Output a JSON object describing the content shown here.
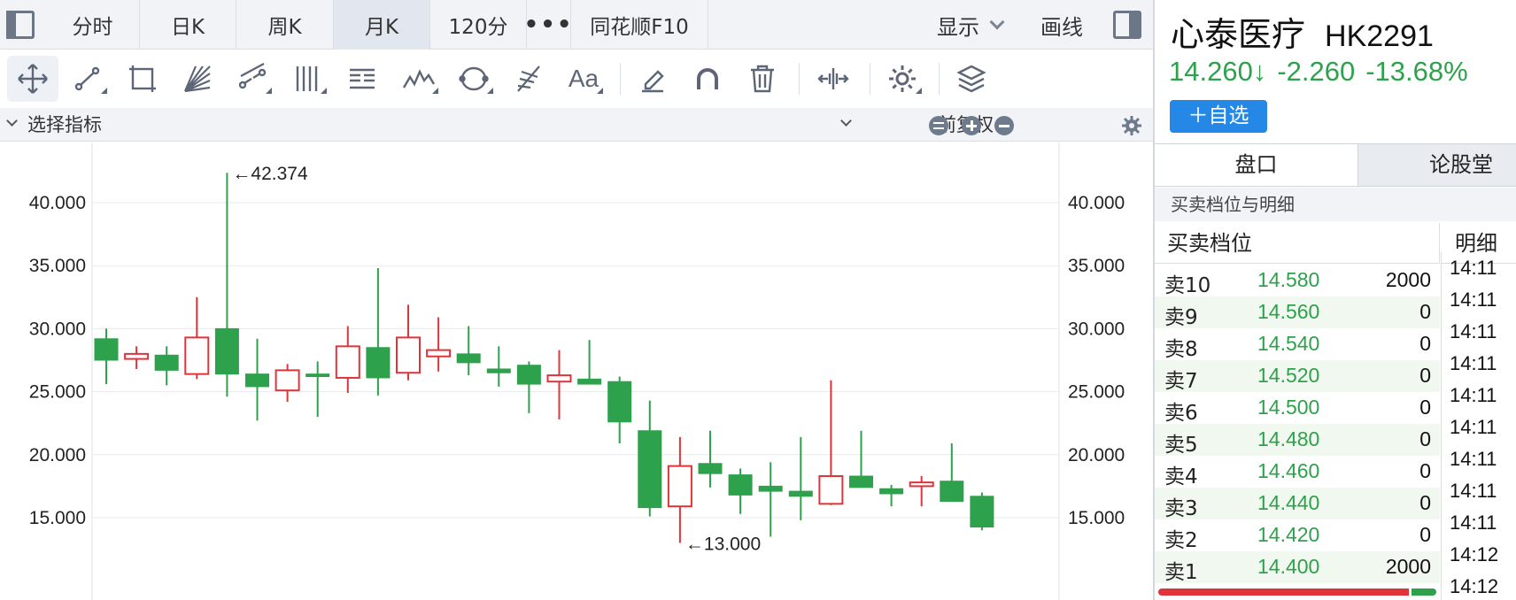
{
  "tabs": [
    "分时",
    "日K",
    "周K",
    "月K",
    "120分",
    "•••",
    "同花顺F10"
  ],
  "active_tab": "月K",
  "display_label": "显示",
  "draw_label": "画线",
  "indicator_bar": {
    "select_label": "选择指标",
    "adjust_label": "前复权"
  },
  "toolbar_icons": [
    "move-icon",
    "line-segment-icon",
    "rectangle-icon",
    "fan-icon",
    "parallel-channel-icon",
    "vertical-lines-icon",
    "text-box-icon",
    "wave-icon",
    "cycle-icon",
    "fibonacci-icon",
    "text-icon",
    "eraser-icon",
    "magnet-icon",
    "trash-icon",
    "fit-width-icon",
    "settings-icon",
    "layers-icon"
  ],
  "toolbar_text_icon": "Aa",
  "chart_data": {
    "type": "candlestick",
    "y_ticks": [
      "40.000",
      "35.000",
      "30.000",
      "25.000",
      "20.000",
      "15.000"
    ],
    "ylim": [
      11.5,
      43.5
    ],
    "grid": true,
    "max_annotation": "←42.374",
    "min_annotation": "←13.000",
    "candles": [
      {
        "o": 29.2,
        "h": 30.0,
        "l": 25.6,
        "c": 27.5
      },
      {
        "o": 27.6,
        "h": 28.6,
        "l": 26.8,
        "c": 28.0
      },
      {
        "o": 27.9,
        "h": 28.6,
        "l": 25.5,
        "c": 26.7
      },
      {
        "o": 26.4,
        "h": 32.5,
        "l": 26.0,
        "c": 29.3
      },
      {
        "o": 30.0,
        "h": 42.374,
        "l": 24.6,
        "c": 26.4
      },
      {
        "o": 26.4,
        "h": 29.2,
        "l": 22.7,
        "c": 25.4
      },
      {
        "o": 25.1,
        "h": 27.2,
        "l": 24.2,
        "c": 26.7
      },
      {
        "o": 26.4,
        "h": 27.4,
        "l": 23.0,
        "c": 26.2
      },
      {
        "o": 26.1,
        "h": 30.2,
        "l": 24.9,
        "c": 28.6
      },
      {
        "o": 28.5,
        "h": 34.8,
        "l": 24.7,
        "c": 26.1
      },
      {
        "o": 26.5,
        "h": 31.9,
        "l": 25.9,
        "c": 29.3
      },
      {
        "o": 27.8,
        "h": 30.9,
        "l": 26.6,
        "c": 28.3
      },
      {
        "o": 28.0,
        "h": 30.2,
        "l": 26.3,
        "c": 27.3
      },
      {
        "o": 26.8,
        "h": 28.6,
        "l": 25.4,
        "c": 26.5
      },
      {
        "o": 27.1,
        "h": 27.4,
        "l": 23.3,
        "c": 25.6
      },
      {
        "o": 25.8,
        "h": 28.3,
        "l": 22.8,
        "c": 26.3
      },
      {
        "o": 26.0,
        "h": 29.1,
        "l": 25.6,
        "c": 25.6
      },
      {
        "o": 25.8,
        "h": 26.2,
        "l": 20.9,
        "c": 22.6
      },
      {
        "o": 21.9,
        "h": 24.3,
        "l": 15.1,
        "c": 15.8
      },
      {
        "o": 15.9,
        "h": 21.4,
        "l": 13.0,
        "c": 19.1
      },
      {
        "o": 19.3,
        "h": 21.9,
        "l": 17.4,
        "c": 18.5
      },
      {
        "o": 18.4,
        "h": 18.9,
        "l": 15.3,
        "c": 16.8
      },
      {
        "o": 17.5,
        "h": 19.4,
        "l": 13.5,
        "c": 17.1
      },
      {
        "o": 17.1,
        "h": 21.4,
        "l": 14.8,
        "c": 16.7
      },
      {
        "o": 16.1,
        "h": 25.9,
        "l": 16.0,
        "c": 18.3
      },
      {
        "o": 18.3,
        "h": 21.9,
        "l": 17.7,
        "c": 17.4
      },
      {
        "o": 17.3,
        "h": 17.6,
        "l": 15.9,
        "c": 16.9
      },
      {
        "o": 17.5,
        "h": 18.3,
        "l": 15.9,
        "c": 17.8
      },
      {
        "o": 17.9,
        "h": 20.9,
        "l": 16.3,
        "c": 16.3
      },
      {
        "o": 16.7,
        "h": 17.0,
        "l": 14.0,
        "c": 14.26
      }
    ]
  },
  "quote": {
    "name": "心泰医疗",
    "code": "HK2291",
    "price": "14.260↓",
    "change": "-2.260",
    "change_pct": "-13.68%",
    "add_watch": "＋自选"
  },
  "right_tabs": [
    "盘口",
    "论股堂"
  ],
  "section_title": "买卖档位与明细",
  "book_header": "买卖档位",
  "detail_header": "明细",
  "order_book": [
    {
      "label": "卖10",
      "price": "14.580",
      "vol": "2000"
    },
    {
      "label": "卖9",
      "price": "14.560",
      "vol": "0"
    },
    {
      "label": "卖8",
      "price": "14.540",
      "vol": "0"
    },
    {
      "label": "卖7",
      "price": "14.520",
      "vol": "0"
    },
    {
      "label": "卖6",
      "price": "14.500",
      "vol": "0"
    },
    {
      "label": "卖5",
      "price": "14.480",
      "vol": "0"
    },
    {
      "label": "卖4",
      "price": "14.460",
      "vol": "0"
    },
    {
      "label": "卖3",
      "price": "14.440",
      "vol": "0"
    },
    {
      "label": "卖2",
      "price": "14.420",
      "vol": "0"
    },
    {
      "label": "卖1",
      "price": "14.400",
      "vol": "2000"
    }
  ],
  "buy_sell_ratio": {
    "sell": 0.9,
    "buy": 0.1
  },
  "detail_times": [
    "14:11",
    "14:11",
    "14:11",
    "14:11",
    "14:11",
    "14:11",
    "14:11",
    "14:11",
    "14:11",
    "14:12",
    "14:12"
  ],
  "colors": {
    "up": "#e0343b",
    "down": "#2ea14c",
    "accent": "#2588e6"
  }
}
